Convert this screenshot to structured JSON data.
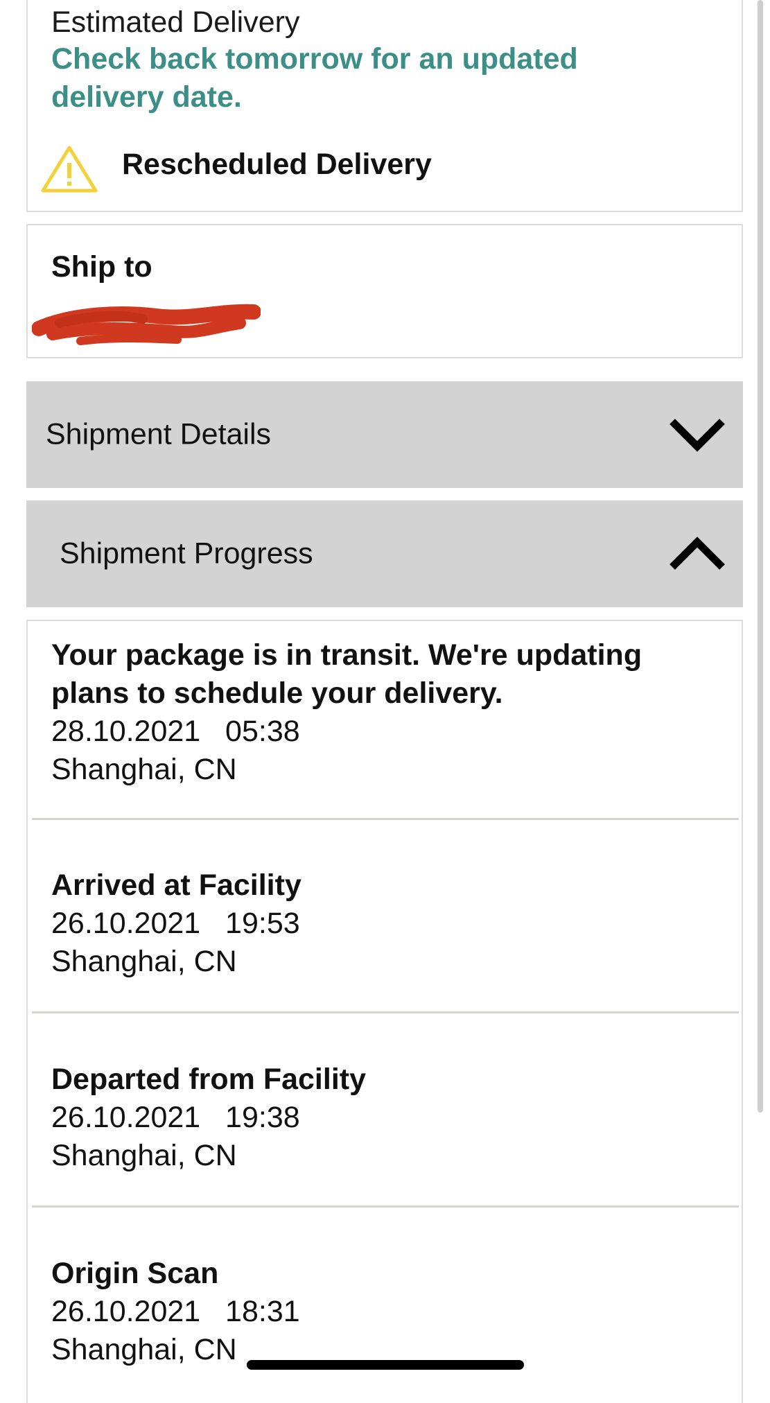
{
  "delivery": {
    "estimated_label": "Estimated Delivery",
    "estimated_value": "Check back tomorrow for an updated delivery date.",
    "status_label": "Rescheduled Delivery",
    "status_icon": "warning-icon",
    "accent_color": "#3c8f86",
    "warning_color": "#f2d13a"
  },
  "ship_to": {
    "label": "Ship to"
  },
  "accordions": {
    "details_label": "Shipment Details",
    "details_icon": "chevron-down-icon",
    "progress_label": "Shipment Progress",
    "progress_icon": "chevron-up-icon"
  },
  "progress": {
    "events": [
      {
        "title": "Your package is in transit. We're updating plans to schedule your delivery.",
        "datetime": "28.10.2021   05:38",
        "location": "Shanghai, CN"
      },
      {
        "title": "Arrived at Facility",
        "datetime": "26.10.2021   19:53",
        "location": "Shanghai, CN"
      },
      {
        "title": "Departed from Facility",
        "datetime": "26.10.2021   19:38",
        "location": "Shanghai, CN"
      },
      {
        "title": "Origin Scan",
        "datetime": "26.10.2021   18:31",
        "location": "Shanghai, CN"
      }
    ]
  }
}
